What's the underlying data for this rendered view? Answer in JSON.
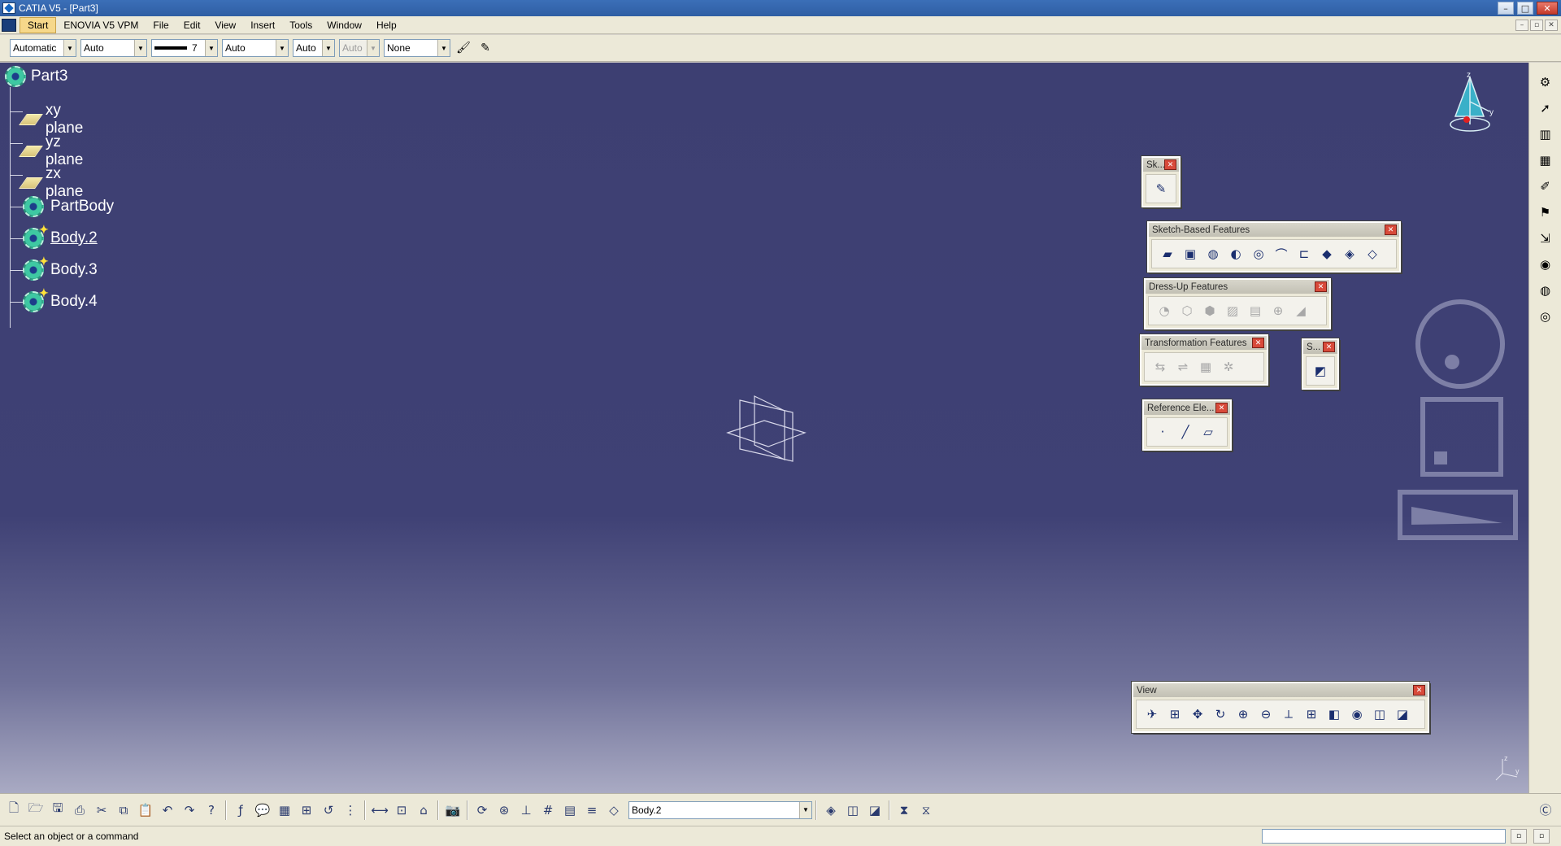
{
  "window": {
    "title": "CATIA V5 - [Part3]",
    "min": "–",
    "max": "□",
    "close": "✕"
  },
  "menubar": {
    "items": [
      "Start",
      "ENOVIA V5 VPM",
      "File",
      "Edit",
      "View",
      "Insert",
      "Tools",
      "Window",
      "Help"
    ],
    "doc_min": "–",
    "doc_restore": "▫",
    "doc_close": "✕"
  },
  "properties": {
    "color": "Automatic",
    "transparency": "Auto",
    "linetype_weight": "7",
    "linetype": "Auto",
    "thickness": "Auto",
    "point": "Auto",
    "layer": "None"
  },
  "tree": {
    "root": "Part3",
    "nodes": [
      "xy plane",
      "yz plane",
      "zx plane",
      "PartBody",
      "Body.2",
      "Body.3",
      "Body.4"
    ]
  },
  "toolbars": {
    "sketcher": {
      "title": "Sk..."
    },
    "sketch_based": {
      "title": "Sketch-Based Features"
    },
    "dress_up": {
      "title": "Dress-Up Features"
    },
    "transformation": {
      "title": "Transformation Features"
    },
    "surface": {
      "title": "S..."
    },
    "reference": {
      "title": "Reference Ele..."
    },
    "view": {
      "title": "View"
    }
  },
  "compass": {
    "z": "z",
    "y": "y"
  },
  "axis_small": {
    "z": "z",
    "y": "y"
  },
  "bottom": {
    "current_body": "Body.2"
  },
  "status": {
    "message": "Select an object or a command"
  },
  "icons": {
    "new": "new-icon",
    "open": "open-icon",
    "save": "save-icon",
    "print": "print-icon",
    "cut": "cut-icon",
    "copy": "copy-icon",
    "paste": "paste-icon",
    "undo": "undo-icon",
    "redo": "redo-icon",
    "whats_this": "help-icon",
    "formula": "formula-icon"
  },
  "colors": {
    "viewport_top": "#3d3f72",
    "viewport_bottom": "#a9aac3",
    "title_bar": "#2f5ea3"
  }
}
